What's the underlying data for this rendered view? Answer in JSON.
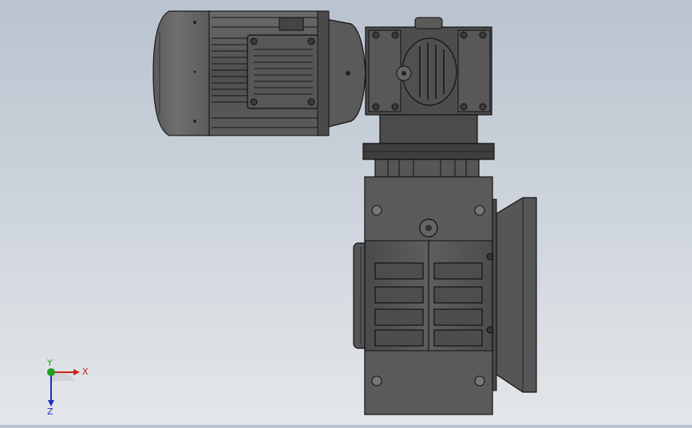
{
  "view": {
    "background_top": "#b9c3cf",
    "background_bottom": "#e4e7ea",
    "model_color": "#555555",
    "edge_color": "#111111"
  },
  "triad": {
    "x_label": "X",
    "y_label": "Y",
    "z_label": "Z",
    "x_color": "#d02020",
    "y_color": "#20a020",
    "z_color": "#2030c0"
  }
}
